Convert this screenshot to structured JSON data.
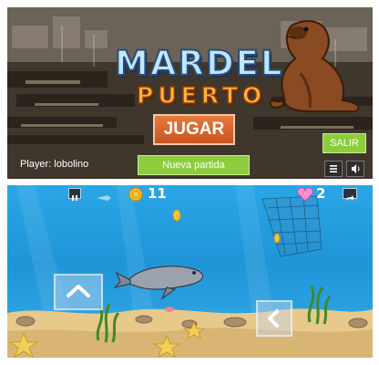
{
  "menu": {
    "title_line1": "MARDEL",
    "title_line2": "PUERTO",
    "play_label": "JUGAR",
    "player_text": "Player: lobolino",
    "new_game_label": "Nueva partida",
    "exit_label": "SALIR",
    "menu_icon": "hamburger-icon",
    "sound_icon": "speaker-icon"
  },
  "game": {
    "coins": "11",
    "lives": "2",
    "pause_icon": "pause-icon",
    "share_icon": "share-arrow-icon",
    "coin_icon": "coin-icon",
    "heart_icon": "heart-icon",
    "up_control_icon": "chevron-up-icon",
    "left_control_icon": "chevron-left-icon"
  },
  "colors": {
    "play_button": "#d9652b",
    "green_button": "#8dcc3e",
    "water": "#2aa6e6",
    "sand": "#e8c98c"
  }
}
